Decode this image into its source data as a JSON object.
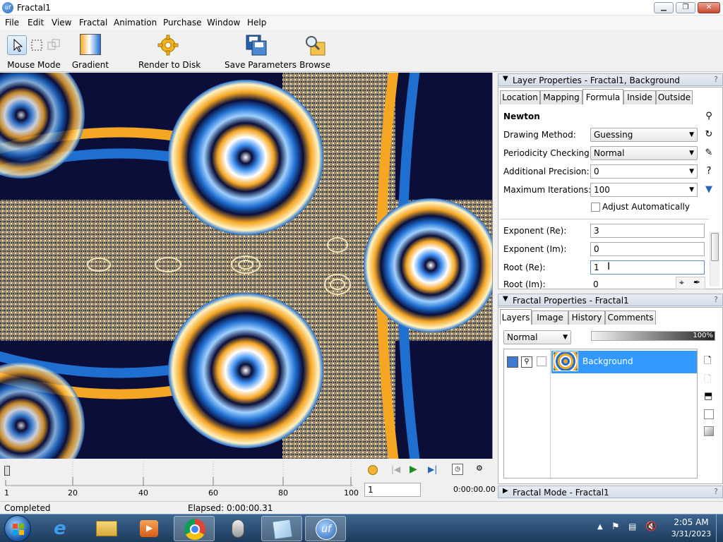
{
  "window": {
    "title": "Fractal1"
  },
  "menu": [
    "File",
    "Edit",
    "View",
    "Fractal",
    "Animation",
    "Purchase",
    "Window",
    "Help"
  ],
  "toolbar": {
    "mouse_mode": "Mouse Mode",
    "gradient": "Gradient",
    "render": "Render to Disk",
    "save": "Save Parameters",
    "browse": "Browse"
  },
  "layer_panel": {
    "header": "Layer Properties - Fractal1, Background",
    "tabs": [
      "Location",
      "Mapping",
      "Formula",
      "Inside",
      "Outside"
    ],
    "active_tab": "Formula",
    "formula_name": "Newton",
    "drawing_method_label": "Drawing Method:",
    "drawing_method": "Guessing",
    "periodicity_label": "Periodicity Checking:",
    "periodicity": "Normal",
    "precision_label": "Additional Precision:",
    "precision": "0",
    "max_iter_label": "Maximum Iterations:",
    "max_iter": "100",
    "adjust_auto": "Adjust Automatically",
    "exp_re_label": "Exponent (Re):",
    "exp_re": "3",
    "exp_im_label": "Exponent (Im):",
    "exp_im": "0",
    "root_re_label": "Root (Re):",
    "root_re": "1",
    "root_im_label": "Root (Im):",
    "root_im": "0"
  },
  "fractal_panel": {
    "header": "Fractal Properties - Fractal1",
    "tabs": [
      "Layers",
      "Image",
      "History",
      "Comments"
    ],
    "active_tab": "Layers",
    "blend_mode": "Normal",
    "opacity": "100%",
    "layer_name": "Background"
  },
  "mode_panel": {
    "header": "Fractal Mode - Fractal1"
  },
  "timeline": {
    "ticks": [
      "1",
      "20",
      "40",
      "60",
      "80",
      "100"
    ],
    "frame": "1",
    "time": "0:00:00.00"
  },
  "status": {
    "text": "Completed",
    "elapsed": "Elapsed: 0:00:00.31"
  },
  "tray": {
    "time": "2:05 AM",
    "date": "3/31/2023"
  },
  "colors": {
    "accent": "#3399ff",
    "fractal_orange": "#f5a623",
    "fractal_blue": "#1f6fd1",
    "fractal_navy": "#0a0e38"
  }
}
